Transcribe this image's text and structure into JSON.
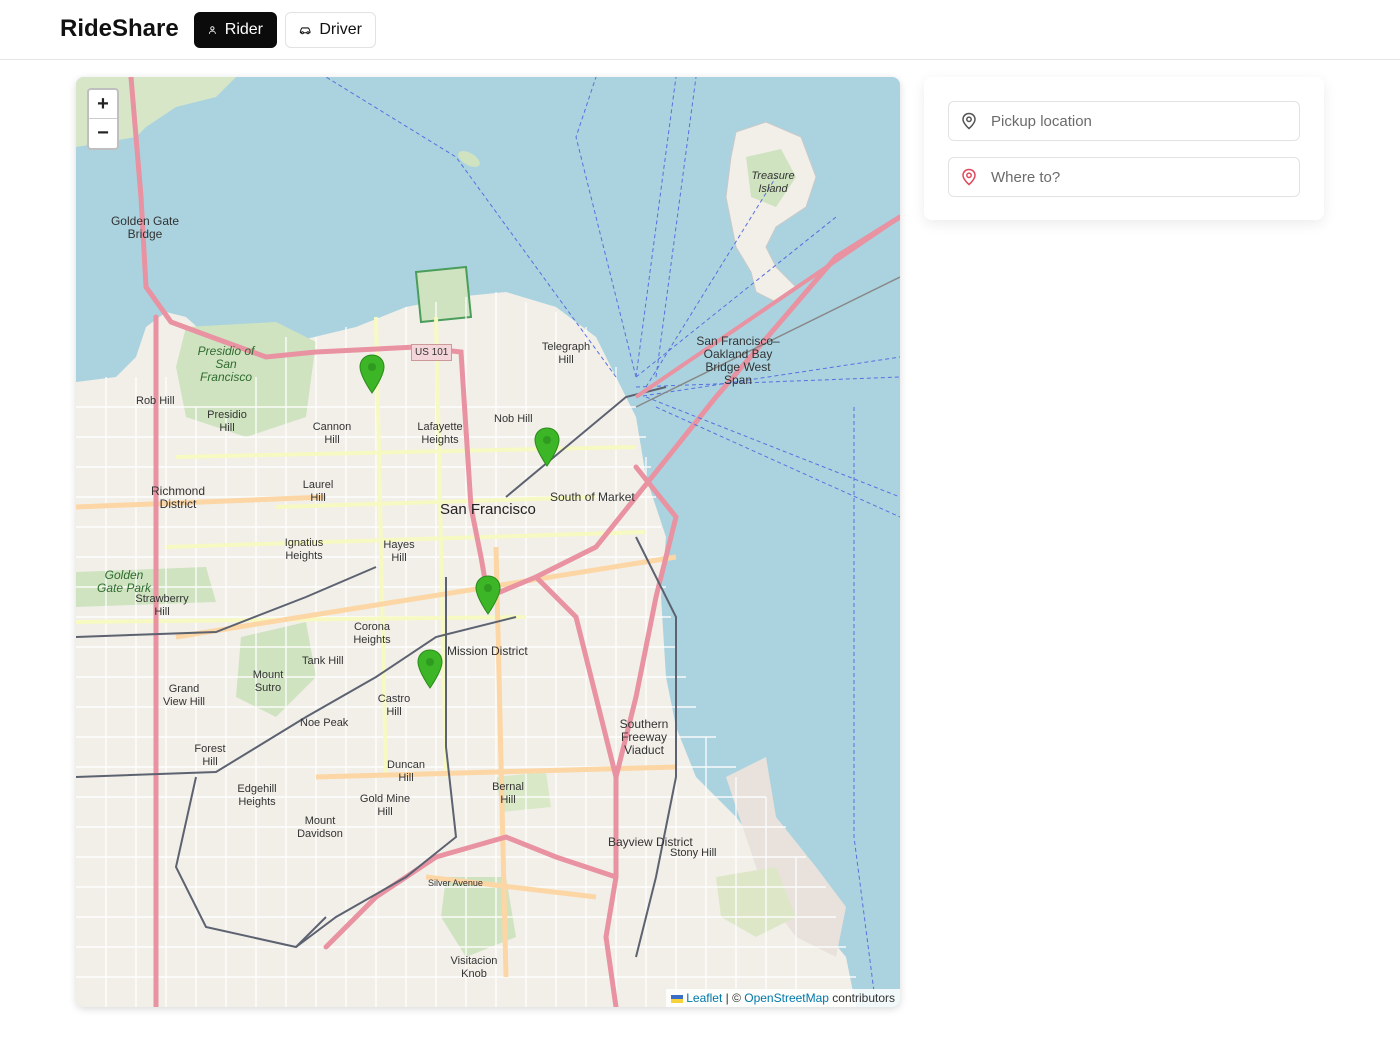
{
  "header": {
    "brand": "RideShare",
    "rider_label": "Rider",
    "driver_label": "Driver"
  },
  "map": {
    "zoom_in": "+",
    "zoom_out": "−",
    "attribution": {
      "leaflet": "Leaflet",
      "separator": " | © ",
      "osm": "OpenStreetMap",
      "suffix": " contributors"
    },
    "labels": {
      "san_francisco": "San Francisco",
      "south_of_market": "South of Market",
      "mission_district": "Mission District",
      "richmond_district": "Richmond District",
      "golden_gate_bridge": "Golden Gate Bridge",
      "golden_gate_park": "Golden Gate Park",
      "presidio": "Presidio of San Francisco",
      "treasure_island": "Treasure Island",
      "bay_bridge": "San Francisco–Oakland Bay Bridge West Span",
      "southern_freeway": "Southern Freeway Viaduct",
      "bayview": "Bayview District",
      "telegraph_hill": "Telegraph Hill",
      "nob_hill": "Nob Hill",
      "lafayette_heights": "Lafayette Heights",
      "cannon_hill": "Cannon Hill",
      "laurel_hill": "Laurel Hill",
      "rob_hill": "Rob Hill",
      "presidio_hill": "Presidio Hill",
      "ignatius_heights": "Ignatius Heights",
      "hayes_hill": "Hayes Hill",
      "corona_heights": "Corona Heights",
      "tank_hill": "Tank Hill",
      "mount_sutro": "Mount Sutro",
      "noe_peak": "Noe Peak",
      "castro_hill": "Castro Hill",
      "forest_hill": "Forest Hill",
      "edgehill_heights": "Edgehill Heights",
      "mount_davidson": "Mount Davidson",
      "gold_mine_hill": "Gold Mine Hill",
      "duncan_hill": "Duncan Hill",
      "bernal_hill": "Bernal Hill",
      "strawberry_hill": "Strawberry Hill",
      "grand_view_hill": "Grand View Hill",
      "stony_hill": "Stony Hill",
      "visitacion_knob": "Visitacion Knob",
      "silver_avenue": "Silver Avenue",
      "us101": "US 101"
    },
    "pins": [
      {
        "name": "driver-pin-1"
      },
      {
        "name": "driver-pin-2"
      },
      {
        "name": "driver-pin-3"
      },
      {
        "name": "driver-pin-4"
      }
    ]
  },
  "panel": {
    "pickup_placeholder": "Pickup location",
    "dropoff_placeholder": "Where to?"
  },
  "colors": {
    "primary": "#0b0b0b",
    "pin_green": "#3cb526",
    "water": "#aad3df",
    "motorway": "#e892a2",
    "dropoff_icon": "#e0495c"
  }
}
